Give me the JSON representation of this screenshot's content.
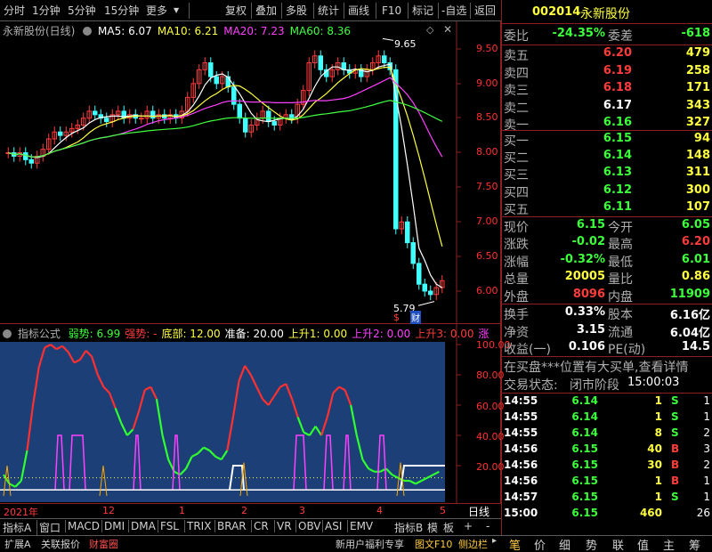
{
  "toolbar": {
    "items": [
      "分时",
      "1分钟",
      "5分钟",
      "15分钟",
      "更多",
      "复权",
      "叠加",
      "多股",
      "统计",
      "画线",
      "F10",
      "标记",
      "-自选",
      "返回"
    ]
  },
  "stock": {
    "code": "002014",
    "name": "永新股份"
  },
  "main_chart": {
    "title": "永新股份(日线)",
    "ma": [
      {
        "label": "MA5: 6.07",
        "color": "#ffffff"
      },
      {
        "label": "MA10: 6.21",
        "color": "#ffff40"
      },
      {
        "label": "MA20: 7.23",
        "color": "#ff40ff"
      },
      {
        "label": "MA60: 8.36",
        "color": "#40ff40"
      }
    ],
    "high_label": "9.65",
    "low_label": "5.79",
    "marker_s": "$",
    "marker_cai": "财",
    "yticks": [
      "9.50",
      "9.00",
      "8.50",
      "8.00",
      "7.50",
      "7.00",
      "6.50",
      "6.00"
    ]
  },
  "indicator": {
    "title": "指标公式",
    "items": [
      {
        "label": "弱势: 6.99",
        "color": "#3cff3c"
      },
      {
        "label": "强势: -",
        "color": "#ff3c3c"
      },
      {
        "label": "底部: 12.00",
        "color": "#ffff40"
      },
      {
        "label": "准备: 20.00",
        "color": "#ffffff"
      },
      {
        "label": "上升1: 0.00",
        "color": "#ffff40"
      },
      {
        "label": "上升2: 0.00",
        "color": "#ff40ff"
      },
      {
        "label": "上升3: 0.00",
        "color": "#ff3c3c"
      },
      {
        "label": "涨",
        "color": "#ff40ff"
      }
    ],
    "yticks": [
      "100.00",
      "80.00",
      "60.00",
      "40.00",
      "20.00"
    ]
  },
  "time_axis": {
    "labels": [
      "2021年",
      "12",
      "1",
      "2",
      "3",
      "4",
      "5"
    ]
  },
  "tabs": [
    "指标A",
    "窗口",
    "MACD",
    "DMI",
    "DMA",
    "FSL",
    "TRIX",
    "BRAR",
    "CR",
    "VR",
    "OBV",
    "ASI",
    "EMV",
    "指标B",
    "模",
    "板",
    "+",
    "-"
  ],
  "period_label": "日线",
  "bottom_bar": {
    "left": [
      "扩展A",
      "关联报价",
      "财富圈"
    ],
    "promo": "新用户福利专享",
    "f10": "图文F10",
    "sidebar": "侧边栏",
    "nav": [
      "笔",
      "价",
      "细",
      "势",
      "联",
      "值",
      "主",
      "筹"
    ]
  },
  "quote": {
    "weibi_label": "委比",
    "weibi": "-24.35%",
    "weicha_label": "委差",
    "weicha": "-618",
    "sell": [
      {
        "label": "卖五",
        "price": "6.20",
        "vol": "479"
      },
      {
        "label": "卖四",
        "price": "6.19",
        "vol": "258"
      },
      {
        "label": "卖三",
        "price": "6.18",
        "vol": "171"
      },
      {
        "label": "卖二",
        "price": "6.17",
        "vol": "343"
      },
      {
        "label": "卖一",
        "price": "6.16",
        "vol": "327"
      }
    ],
    "buy": [
      {
        "label": "买一",
        "price": "6.15",
        "vol": "94"
      },
      {
        "label": "买二",
        "price": "6.14",
        "vol": "148"
      },
      {
        "label": "买三",
        "price": "6.13",
        "vol": "311"
      },
      {
        "label": "买四",
        "price": "6.12",
        "vol": "300"
      },
      {
        "label": "买五",
        "price": "6.11",
        "vol": "107"
      }
    ],
    "stats": [
      {
        "l1": "现价",
        "v1": "6.15",
        "c1": "green",
        "l2": "今开",
        "v2": "6.05",
        "c2": "green"
      },
      {
        "l1": "涨跌",
        "v1": "-0.02",
        "c1": "green",
        "l2": "最高",
        "v2": "6.20",
        "c2": "red"
      },
      {
        "l1": "涨幅",
        "v1": "-0.32%",
        "c1": "green",
        "l2": "最低",
        "v2": "6.01",
        "c2": "green"
      },
      {
        "l1": "总量",
        "v1": "20005",
        "c1": "yellow",
        "l2": "量比",
        "v2": "0.86",
        "c2": "yellow"
      },
      {
        "l1": "外盘",
        "v1": "8096",
        "c1": "red",
        "l2": "内盘",
        "v2": "11909",
        "c2": "green"
      }
    ],
    "stats2": [
      {
        "l1": "换手",
        "v1": "0.33%",
        "l2": "股本",
        "v2": "6.16亿"
      },
      {
        "l1": "净资",
        "v1": "3.15",
        "l2": "流通",
        "v2": "6.04亿"
      },
      {
        "l1": "收益(一)",
        "v1": "0.106",
        "l2": "PE(动)",
        "v2": "14.5"
      }
    ],
    "notice": "在买盘***位置有大买单,查看详情",
    "trade_status_label": "交易状态:",
    "trade_status": "闭市阶段",
    "trade_time": "15:00:03"
  },
  "ticks": [
    {
      "time": "14:55",
      "price": "6.14",
      "vol": "1",
      "bs": "S",
      "n": "1"
    },
    {
      "time": "14:55",
      "price": "6.14",
      "vol": "1",
      "bs": "S",
      "n": "1"
    },
    {
      "time": "14:55",
      "price": "6.14",
      "vol": "8",
      "bs": "S",
      "n": "2"
    },
    {
      "time": "14:56",
      "price": "6.15",
      "vol": "40",
      "bs": "B",
      "n": "3"
    },
    {
      "time": "14:56",
      "price": "6.15",
      "vol": "30",
      "bs": "B",
      "n": "2"
    },
    {
      "time": "14:56",
      "price": "6.15",
      "vol": "1",
      "bs": "B",
      "n": "1"
    },
    {
      "time": "14:57",
      "price": "6.15",
      "vol": "1",
      "bs": "S",
      "n": "1"
    },
    {
      "time": "15:00",
      "price": "6.15",
      "vol": "460",
      "bs": "",
      "n": "26"
    }
  ]
}
